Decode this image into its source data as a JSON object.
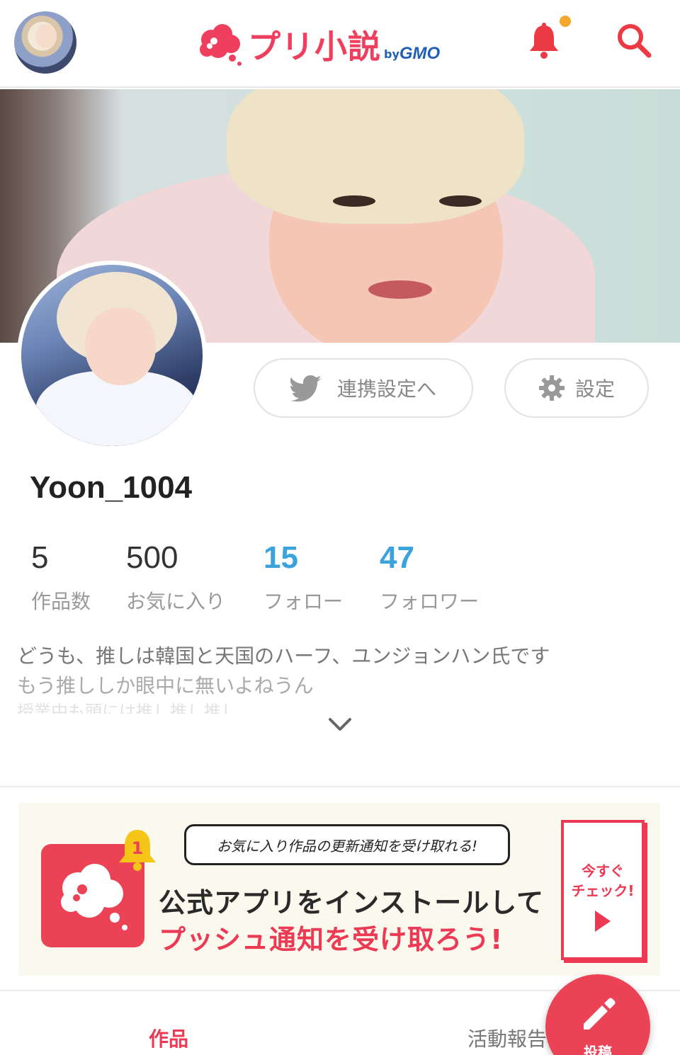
{
  "header": {
    "logo_text": "プリ小説",
    "logo_by": "by",
    "logo_gmo": "GMO"
  },
  "profile": {
    "link_button_label": "連携設定へ",
    "settings_button_label": "設定",
    "username": "Yoon_1004"
  },
  "stats": [
    {
      "value": "5",
      "label": "作品数"
    },
    {
      "value": "500",
      "label": "お気に入り"
    },
    {
      "value": "15",
      "label": "フォロー"
    },
    {
      "value": "47",
      "label": "フォロワー"
    }
  ],
  "bio": {
    "line1": "どうも、推しは韓国と天国のハーフ、ユンジョンハン氏です",
    "line2": "もう推ししか眼中に無いよねうん",
    "line3": "授業中も頭には推し推し推し"
  },
  "banner": {
    "bubble": "お気に入り作品の更新通知を受け取れる!",
    "line1": "公式アプリをインストールして",
    "line2": "プッシュ通知を受け取ろう!",
    "check_text": "今すぐ\nチェック!",
    "badge_count": "1"
  },
  "tabs": {
    "works": "作品",
    "activity": "活動報告"
  },
  "fab": {
    "label": "投稿"
  },
  "colors": {
    "brand": "#ec4256",
    "accent_blue": "#3aa3de",
    "notification_dot": "#f4a72d"
  }
}
